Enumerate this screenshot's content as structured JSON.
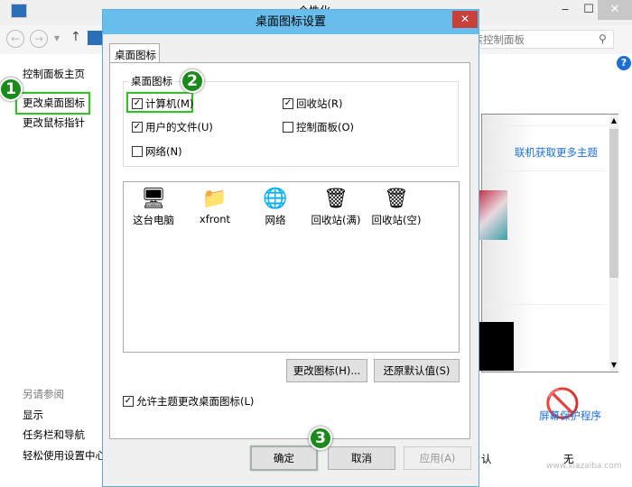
{
  "window": {
    "title": "个性化",
    "minimize": "‒",
    "maximize": "☐",
    "close": "✕"
  },
  "nav": {
    "back": "←",
    "forward": "→",
    "dropdown": "▾",
    "up": "↑",
    "search_placeholder": "搜索控制面板"
  },
  "sidebar": {
    "items": [
      {
        "label": "控制面板主页"
      },
      {
        "label": "更改桌面图标"
      },
      {
        "label": "更改鼠标指针"
      }
    ],
    "see_also": "另请参阅",
    "see_also_items": [
      {
        "label": "显示"
      },
      {
        "label": "任务栏和导航"
      },
      {
        "label": "轻松使用设置中心"
      }
    ]
  },
  "content": {
    "online_themes": "联机获取更多主题",
    "screensaver": "屏幕保护程序",
    "screensaver_value": "无",
    "partial_label": "认",
    "help": "?"
  },
  "badges": [
    "1",
    "2",
    "3"
  ],
  "dialog": {
    "title": "桌面图标设置",
    "close": "✕",
    "tab": "桌面图标",
    "group_label": "桌面图标",
    "checkboxes": [
      {
        "label": "计算机(M)",
        "checked": true
      },
      {
        "label": "回收站(R)",
        "checked": true
      },
      {
        "label": "用户的文件(U)",
        "checked": true
      },
      {
        "label": "控制面板(O)",
        "checked": false
      },
      {
        "label": "网络(N)",
        "checked": false
      }
    ],
    "icons": [
      {
        "label": "这台电脑",
        "glyph": "🖥"
      },
      {
        "label": "xfront",
        "glyph": "📁"
      },
      {
        "label": "网络",
        "glyph": "🌐"
      },
      {
        "label": "回收站(满)",
        "glyph": "🗑"
      },
      {
        "label": "回收站(空)",
        "glyph": "🗑"
      }
    ],
    "change_icon": "更改图标(H)...",
    "restore_default": "还原默认值(S)",
    "allow_themes": {
      "label": "允许主题更改桌面图标(L)",
      "checked": true
    },
    "ok": "确定",
    "cancel": "取消",
    "apply": "应用(A)"
  },
  "watermark": "www.xiazaiba.com",
  "colors": {
    "title_accent": "#67bdec",
    "close_red": "#c9403b",
    "highlight_green": "#3dbb2e",
    "badge_green": "#1a8a1a",
    "link_blue": "#1c6fd6"
  }
}
